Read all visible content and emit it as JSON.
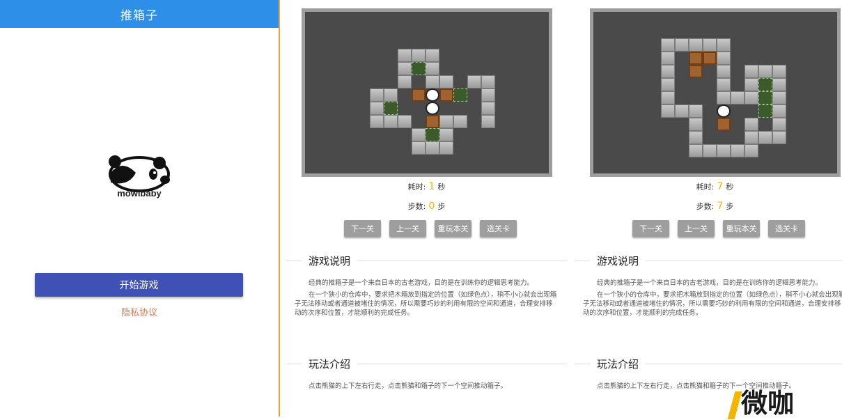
{
  "left": {
    "app_title": "推箱子",
    "logo_text": "mowibaby",
    "start_button": "开始游戏",
    "privacy_link": "隐私协议"
  },
  "panels": [
    {
      "time_label": "耗时:",
      "time_value": "1",
      "time_unit": "秒",
      "steps_label": "步数:",
      "steps_value": "0",
      "steps_unit": "步"
    },
    {
      "time_label": "耗时:",
      "time_value": "7",
      "time_unit": "秒",
      "steps_label": "步数:",
      "steps_value": "7",
      "steps_unit": "步"
    }
  ],
  "buttons": {
    "next": "下一关",
    "prev": "上一关",
    "replay": "重玩本关",
    "select": "选关卡"
  },
  "intro": {
    "title": "游戏说明",
    "p1": "经典的推箱子是一个来自日本的古老游戏，目的是在训练你的逻辑思考能力。",
    "p2": "在一个狭小的仓库中，要求把木箱放到指定的位置（如绿色点），稍不小心就会出现箱子无法移动或者通道被堵住的情况，所以需要巧妙的利用有限的空间和通道，合理安排移动的次序和位置，才能顺利的完成任务。"
  },
  "howto": {
    "title": "玩法介绍",
    "p1": "点击熊猫的上下左右行走，点击熊猫和箱子的下一个空间推动箱子。"
  },
  "watermark": "微咖",
  "colors": {
    "appbar": "#2d8fe8",
    "start_button": "#3f51b5",
    "privacy": "#e07a50",
    "accent_number": "#f4b400"
  }
}
